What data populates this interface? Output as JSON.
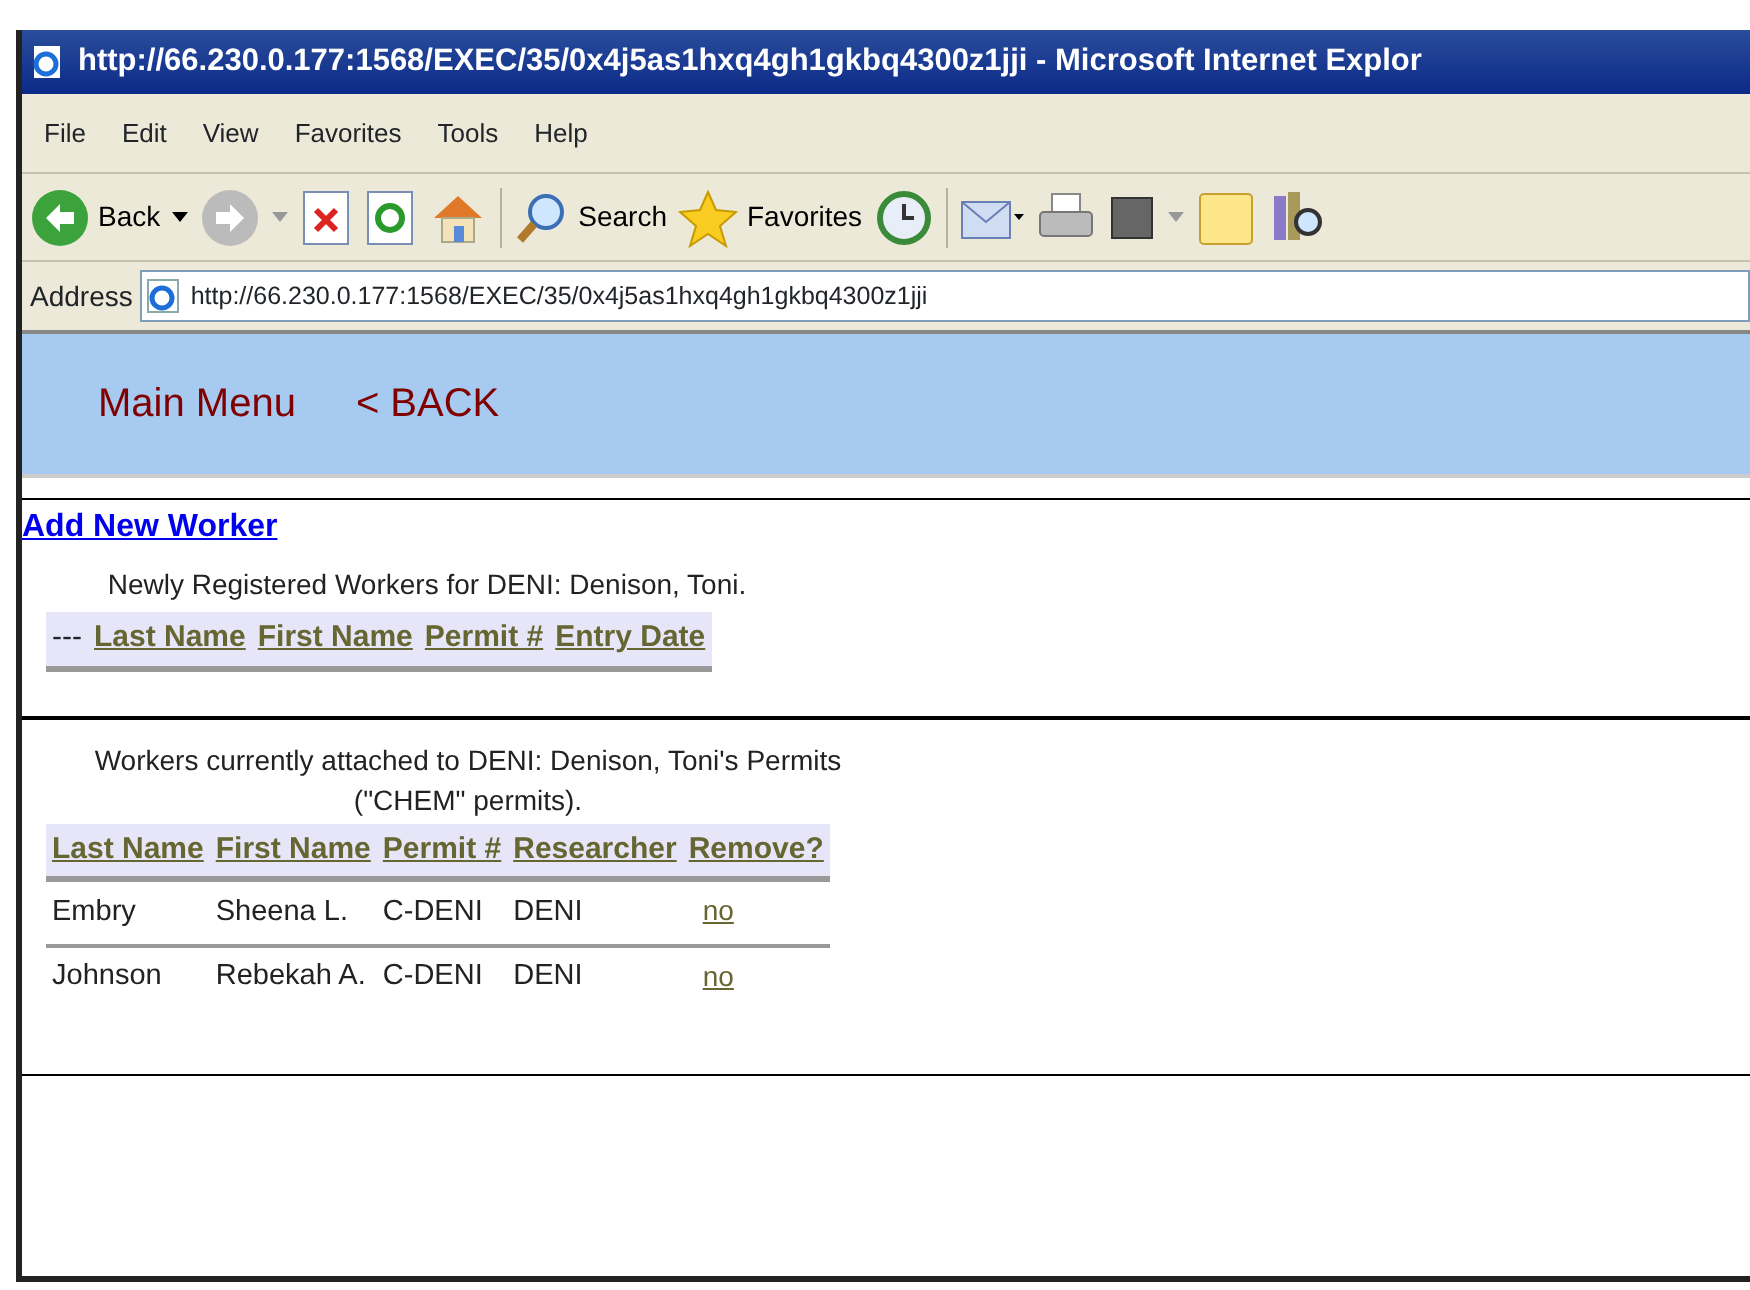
{
  "window": {
    "title": "http://66.230.0.177:1568/EXEC/35/0x4j5as1hxq4gh1gkbq4300z1jji - Microsoft Internet Explor"
  },
  "menu": [
    "File",
    "Edit",
    "View",
    "Favorites",
    "Tools",
    "Help"
  ],
  "toolbar": {
    "back": "Back",
    "search": "Search",
    "favorites": "Favorites"
  },
  "address": {
    "label": "Address",
    "value": "http://66.230.0.177:1568/EXEC/35/0x4j5as1hxq4gh1gkbq4300z1jji"
  },
  "nav_links": [
    "Main Menu",
    "< BACK"
  ],
  "add_link": "Add New Worker",
  "new_workers": {
    "caption": "Newly Registered Workers for DENI: Denison, Toni.",
    "columns": [
      {
        "label": "---",
        "kind": "text"
      },
      {
        "label": "Last Name",
        "kind": "link"
      },
      {
        "label": "First Name",
        "kind": "link"
      },
      {
        "label": "Permit #",
        "kind": "link"
      },
      {
        "label": "Entry Date",
        "kind": "link"
      }
    ]
  },
  "attached_workers": {
    "caption": "Workers currently attached to DENI: Denison, Toni's Permits (\"CHEM\" permits).",
    "columns": [
      "Last Name",
      "First Name",
      "Permit #",
      "Researcher",
      "Remove?"
    ],
    "rows": [
      [
        "Embry",
        "Sheena L.",
        "C-DENI",
        "DENI",
        "no"
      ],
      [
        "Johnson",
        "Rebekah A.",
        "C-DENI",
        "DENI",
        "no"
      ]
    ]
  }
}
